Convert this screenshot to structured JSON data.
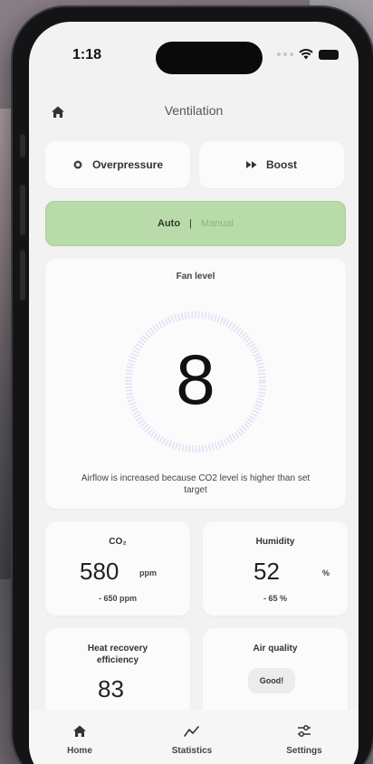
{
  "status": {
    "time": "1:18"
  },
  "header": {
    "title": "Ventilation"
  },
  "modes": {
    "overpressure_label": "Overpressure",
    "boost_label": "Boost"
  },
  "control": {
    "auto_label": "Auto",
    "separator": "|",
    "manual_label": "Manual"
  },
  "fan": {
    "label": "Fan level",
    "value": "8",
    "note": "Airflow is increased because CO2 level is higher than set target"
  },
  "metrics": {
    "co2": {
      "title": "CO₂",
      "value": "580",
      "unit": "ppm",
      "target": "- 650 ppm"
    },
    "humidity": {
      "title": "Humidity",
      "value": "52",
      "unit": "%",
      "target": "- 65 %"
    },
    "heat": {
      "title": "Heat recovery efficiency",
      "value": "83"
    },
    "air": {
      "title": "Air quality",
      "badge": "Good!"
    }
  },
  "tabs": [
    {
      "label": "Home",
      "icon": "home-icon"
    },
    {
      "label": "Statistics",
      "icon": "chart-line-icon"
    },
    {
      "label": "Settings",
      "icon": "sliders-icon"
    }
  ],
  "colors": {
    "auto_bg": "#b9dba9",
    "dial_ring": "#dfe1f5"
  }
}
